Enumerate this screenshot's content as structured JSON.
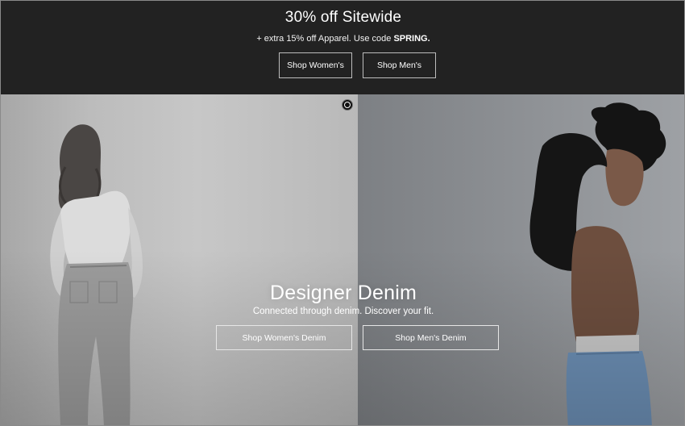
{
  "promo": {
    "title": "30% off Sitewide",
    "subtitle_prefix": "+ extra 15% off Apparel. Use code ",
    "code": "SPRING.",
    "buttons": {
      "women": "Shop Women's",
      "men": "Shop Men's"
    },
    "background_color": "#222222"
  },
  "hero": {
    "title": "Designer Denim",
    "subtitle": "Connected through denim. Discover your fit.",
    "buttons": {
      "women": "Shop Women's Denim",
      "men": "Shop Men's Denim"
    },
    "pause_icon": "pause-play-icon",
    "images": {
      "left": "woman-back-jeans-photo",
      "right": "man-cropped-top-jeans-photo"
    }
  }
}
